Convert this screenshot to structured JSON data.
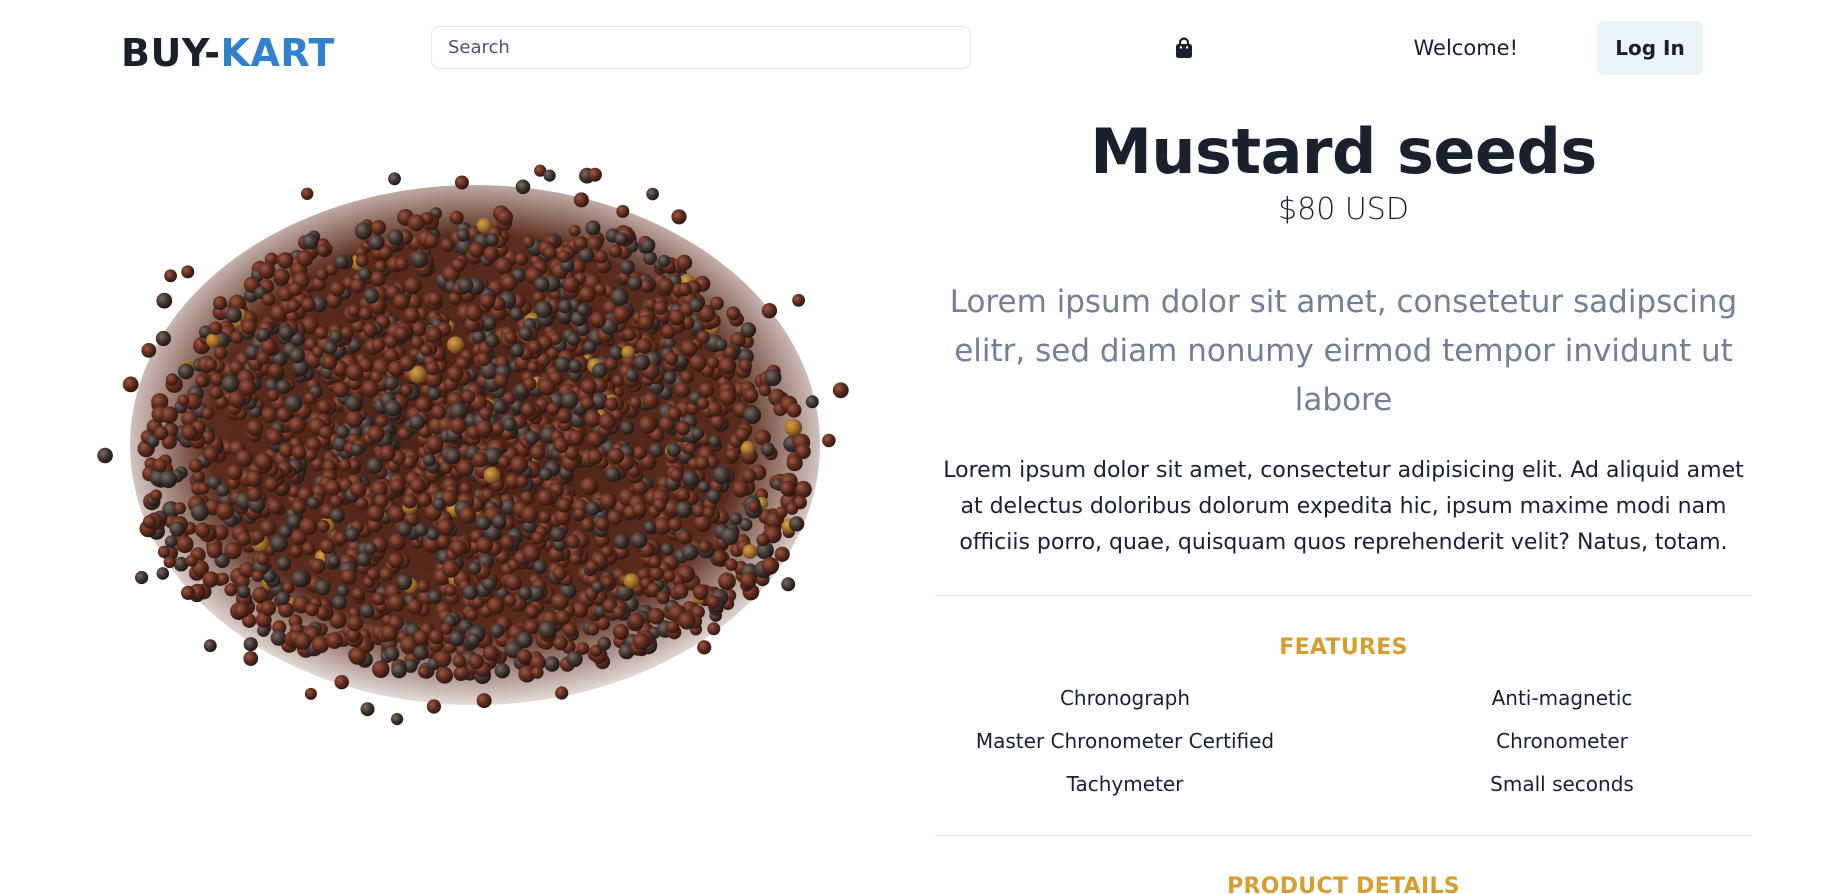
{
  "header": {
    "logo_part1": "BUY-",
    "logo_part2": "KART",
    "search_placeholder": "Search",
    "cart_icon": "shopping-bag-icon",
    "welcome_text": "Welcome!",
    "login_label": "Log In"
  },
  "product": {
    "image_alt": "Mustard seeds",
    "title": "Mustard seeds",
    "price": "$80 USD",
    "subtitle": "Lorem ipsum dolor sit amet, consetetur sadipscing elitr, sed diam nonumy eirmod tempor invidunt ut labore",
    "description": "Lorem ipsum dolor sit amet, consectetur adipisicing elit. Ad aliquid amet at delectus doloribus dolorum expedita hic, ipsum maxime modi nam officiis porro, quae, quisquam quos reprehenderit velit? Natus, totam.",
    "features_heading": "FEATURES",
    "features": [
      "Chronograph",
      "Anti-magnetic",
      "Master Chronometer Certified",
      "Chronometer",
      "Tachymeter",
      "Small seconds"
    ],
    "details_heading": "PRODUCT DETAILS"
  },
  "colors": {
    "brand_dark": "#1a202c",
    "brand_blue": "#3182ce",
    "accent_gold": "#d69e2e",
    "muted_text": "#718096"
  }
}
